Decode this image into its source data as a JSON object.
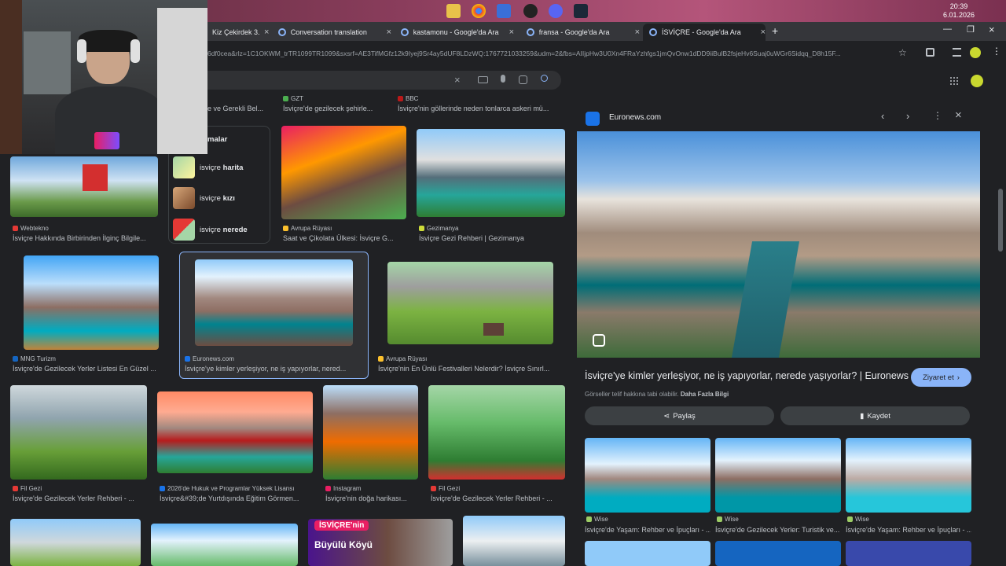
{
  "taskbar": {
    "time": "20:39",
    "date": "6.01.2026"
  },
  "tabs": [
    {
      "label": "Kiz Çekirdek 3..."
    },
    {
      "label": "Conversation translation"
    },
    {
      "label": "kastamonu - Google'da Ara"
    },
    {
      "label": "fransa - Google'da Ara"
    },
    {
      "label": "İSVİÇRE - Google'da Ara"
    }
  ],
  "url": "6df0cea&rlz=1C1OKWM_trTR1099TR1099&sxsrf=AE3TifMGfz12k9Iyej9Sr4ay5dUF8LDzWQ:1767721033259&udm=2&fbs=AIIjpHw3U0Xn4FRaYzhfgs1jmQvOnw1dDD9iiBulB2fsjeHv6Suaj0uWGr6Sidqq_D8h15F...",
  "results_top": [
    {
      "source": "",
      "caption": "e ve Gerekli Bel..."
    },
    {
      "source": "GZT",
      "caption": "İsviçre'de gezilecek şehirle..."
    },
    {
      "source": "BBC",
      "caption": "İsviçre'nin göllerinde neden tonlarca askeri mü..."
    }
  ],
  "related": {
    "header": "malar",
    "items": [
      {
        "prefix": "isviçre",
        "bold": "harita"
      },
      {
        "prefix": "isviçre",
        "bold": "kızı"
      },
      {
        "prefix": "isviçre",
        "bold": "nerede"
      }
    ]
  },
  "row1": [
    {
      "source": "Webtekno",
      "caption": "İsviçre Hakkında Birbirinden İlginç Bilgile..."
    },
    {
      "source": "Avrupa Rüyası",
      "caption": "Saat ve Çikolata Ülkesi: İsviçre G..."
    },
    {
      "source": "Gezimanya",
      "caption": "İsviçre Gezi Rehberi | Gezimanya"
    }
  ],
  "row2": [
    {
      "source": "MNG Turizm",
      "caption": "İsviçre'de Gezilecek Yerler Listesi En Güzel ..."
    },
    {
      "source": "Euronews.com",
      "caption": "İsviçre'ye kimler yerleşiyor, ne iş yapıyorlar, nered..."
    },
    {
      "source": "Avrupa Rüyası",
      "caption": "İsviçre'nin En Ünlü Festivalleri Nelerdir? İsviçre Sınırl..."
    }
  ],
  "row3": [
    {
      "source": "Fil Gezi",
      "caption": "İsviçre'de Gezilecek Yerler Rehberi - ..."
    },
    {
      "source": "2026'de Hukuk ve Programlar Yüksek Lisansı",
      "caption": "İsviçre&#39;de Yurtdışında Eğitim Görmen..."
    },
    {
      "source": "Instagram",
      "caption": "İsviçre'nin doğa harikası..."
    },
    {
      "source": "Fil Gezi",
      "caption": "İsviçre'de Gezilecek Yerler Rehberi - ..."
    }
  ],
  "row4_banner": {
    "line1": "İSVİÇRE'nin",
    "line2": "Büyülü Köyü"
  },
  "panel": {
    "site": "Euronews.com",
    "title": "İsviçre'ye kimler yerleşiyor, ne iş yapıyorlar, nerede yaşıyorlar? | Euronews",
    "visit": "Ziyaret et",
    "copyright": "Görseller telif hakkına tabi olabilir.",
    "more_info": "Daha Fazla Bilgi",
    "share": "Paylaş",
    "save": "Kaydet",
    "related": [
      {
        "source": "Wise",
        "caption": "İsviçre'de Yaşam: Rehber ve İpuçları - ..."
      },
      {
        "source": "Wise",
        "caption": "İsviçre'de Gezilecek Yerler: Turistik ve..."
      },
      {
        "source": "Wise",
        "caption": "İsviçre'de Yaşam: Rehber ve İpuçları - ..."
      }
    ]
  },
  "colors": {
    "accent": "#8ab4f8",
    "background": "#202124",
    "visit_button": "#8ab4f8"
  }
}
